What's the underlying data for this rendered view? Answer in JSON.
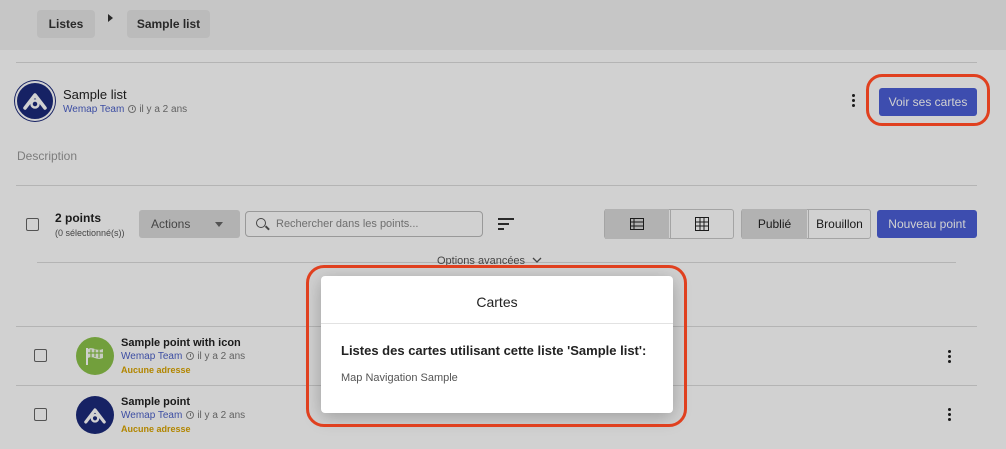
{
  "breadcrumb": {
    "root": "Listes",
    "current": "Sample list"
  },
  "list": {
    "title": "Sample list",
    "author": "Wemap Team",
    "time": "il y a 2 ans",
    "cta": "Voir ses cartes",
    "description_placeholder": "Description"
  },
  "toolbar": {
    "count": "2 points",
    "selected": "(0 sélectionné(s))",
    "actions": "Actions",
    "search_placeholder": "Rechercher dans les points...",
    "status_published": "Publié",
    "status_draft": "Brouillon",
    "new_point": "Nouveau point",
    "advanced": "Options avancées"
  },
  "points": [
    {
      "title": "Sample point with icon",
      "author": "Wemap Team",
      "time": "il y a 2 ans",
      "address": "Aucune adresse"
    },
    {
      "title": "Sample point",
      "author": "Wemap Team",
      "time": "il y a 2 ans",
      "address": "Aucune adresse"
    }
  ],
  "modal": {
    "title": "Cartes",
    "heading": "Listes des cartes utilisant cette liste 'Sample list':",
    "items": [
      "Map Navigation Sample"
    ]
  },
  "colors": {
    "primary": "#4b5fd6",
    "brand_dark": "#1c2a7a",
    "icon_green": "#8bc34a",
    "address": "#d9a400",
    "highlight": "#e0401f"
  }
}
